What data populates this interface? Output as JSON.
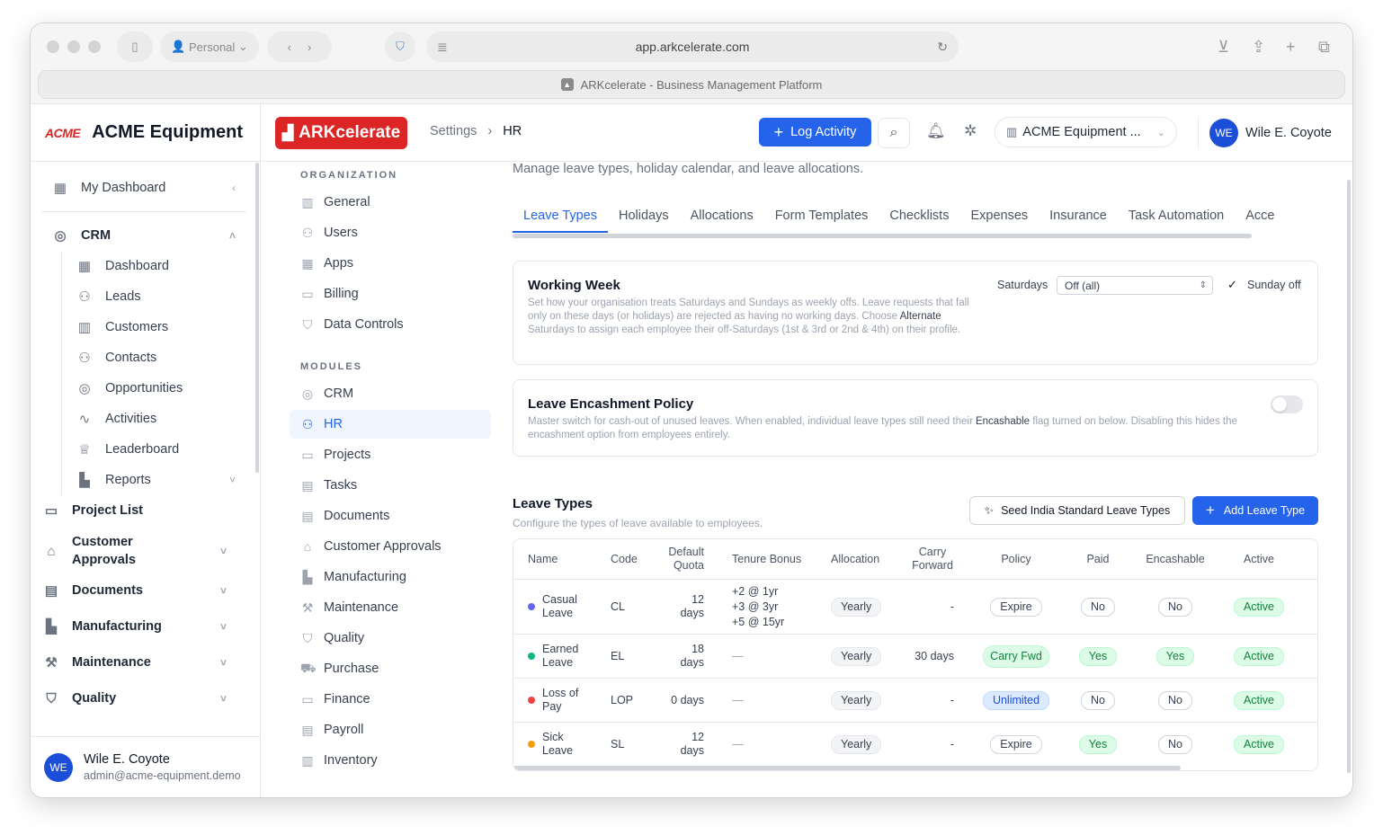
{
  "browser": {
    "profile": "Personal",
    "url": "app.arkcelerate.com",
    "tab_title": "ARKcelerate - Business Management Platform"
  },
  "sidebar": {
    "logo_text": "ACME",
    "company": "ACME Equipment",
    "items": [
      {
        "label": "My Dashboard",
        "icon": "dashboard-icon"
      },
      {
        "label": "CRM",
        "icon": "target-icon"
      },
      {
        "label": "Dashboard",
        "icon": "dashboard-icon"
      },
      {
        "label": "Leads",
        "icon": "user-plus-icon"
      },
      {
        "label": "Customers",
        "icon": "building-icon"
      },
      {
        "label": "Contacts",
        "icon": "users-icon"
      },
      {
        "label": "Opportunities",
        "icon": "target-icon"
      },
      {
        "label": "Activities",
        "icon": "activity-icon"
      },
      {
        "label": "Leaderboard",
        "icon": "trophy-icon"
      },
      {
        "label": "Reports",
        "icon": "bar-chart-icon"
      },
      {
        "label": "Project List",
        "icon": "folder-icon"
      },
      {
        "label": "Customer Approvals",
        "icon": "tag-icon"
      },
      {
        "label": "Documents",
        "icon": "document-icon"
      },
      {
        "label": "Manufacturing",
        "icon": "factory-icon"
      },
      {
        "label": "Maintenance",
        "icon": "wrench-icon"
      },
      {
        "label": "Quality",
        "icon": "shield-icon"
      }
    ],
    "user": {
      "initials": "WE",
      "name": "Wile E. Coyote",
      "email": "admin@acme-equipment.demo"
    }
  },
  "topbar": {
    "brand": "ARKcelerate",
    "breadcrumb": [
      "Settings",
      "HR"
    ],
    "log_activity": "Log Activity",
    "company_selector": "ACME Equipment ...",
    "user_initials": "WE",
    "user_name": "Wile E. Coyote"
  },
  "settings_nav": {
    "org_label": "ORGANIZATION",
    "org_items": [
      "General",
      "Users",
      "Apps",
      "Billing",
      "Data Controls"
    ],
    "modules_label": "MODULES",
    "module_items": [
      "CRM",
      "HR",
      "Projects",
      "Tasks",
      "Documents",
      "Customer Approvals",
      "Manufacturing",
      "Maintenance",
      "Quality",
      "Purchase",
      "Finance",
      "Payroll",
      "Inventory"
    ],
    "active": "HR"
  },
  "main": {
    "description": "Manage leave types, holiday calendar, and leave allocations.",
    "tabs": [
      "Leave Types",
      "Holidays",
      "Allocations",
      "Form Templates",
      "Checklists",
      "Expenses",
      "Insurance",
      "Task Automation",
      "Acce"
    ],
    "working_week": {
      "title": "Working Week",
      "desc_1": "Set how your organisation treats Saturdays and Sundays as weekly offs. Leave requests that fall only on these days (or holidays) are rejected as having no working days. Choose ",
      "desc_bold": "Alternate",
      "desc_2": " Saturdays to assign each employee their off-Saturdays (1st & 3rd or 2nd & 4th) on their profile.",
      "saturdays_label": "Saturdays",
      "saturdays_value": "Off (all)",
      "sunday_off": "Sunday off"
    },
    "encashment": {
      "title": "Leave Encashment Policy",
      "desc_1": "Master switch for cash-out of unused leaves. When enabled, individual leave types still need their ",
      "desc_bold": "Encashable",
      "desc_2": " flag turned on below. Disabling this hides the encashment option from employees entirely."
    },
    "leave_types": {
      "title": "Leave Types",
      "subtitle": "Configure the types of leave available to employees.",
      "seed_button": "Seed India Standard Leave Types",
      "add_button": "Add Leave Type",
      "columns": [
        "Name",
        "Code",
        "Default Quota",
        "Tenure Bonus",
        "Allocation",
        "Carry Forward",
        "Policy",
        "Paid",
        "Encashable",
        "Active"
      ],
      "rows": [
        {
          "name": "Casual Leave",
          "color": "#6366f1",
          "code": "CL",
          "quota": "12 days",
          "tenure": "+2 @ 1yr\n+3 @ 3yr\n+5 @ 15yr",
          "allocation": "Yearly",
          "carry": "-",
          "policy": "Expire",
          "paid": "No",
          "encashable": "No",
          "active": "Active"
        },
        {
          "name": "Earned Leave",
          "color": "#10b981",
          "code": "EL",
          "quota": "18 days",
          "tenure": "—",
          "allocation": "Yearly",
          "carry": "30 days",
          "policy": "Carry Fwd",
          "paid": "Yes",
          "encashable": "Yes",
          "active": "Active"
        },
        {
          "name": "Loss of Pay",
          "color": "#ef4444",
          "code": "LOP",
          "quota": "0 days",
          "tenure": "—",
          "allocation": "Yearly",
          "carry": "-",
          "policy": "Unlimited",
          "paid": "No",
          "encashable": "No",
          "active": "Active"
        },
        {
          "name": "Sick Leave",
          "color": "#f59e0b",
          "code": "SL",
          "quota": "12 days",
          "tenure": "—",
          "allocation": "Yearly",
          "carry": "-",
          "policy": "Expire",
          "paid": "Yes",
          "encashable": "No",
          "active": "Active"
        }
      ]
    }
  }
}
